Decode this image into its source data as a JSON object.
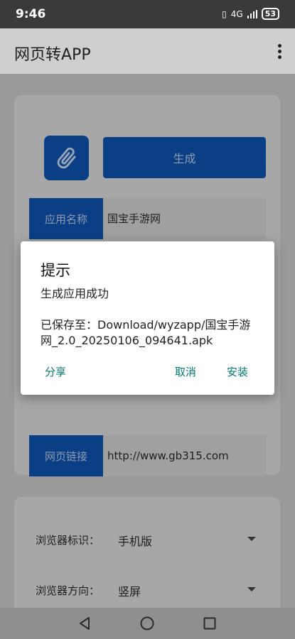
{
  "status_bar": {
    "time": "9:46",
    "network": "4G",
    "battery": "53"
  },
  "app_bar": {
    "title": "网页转APP",
    "menu_icon": "more-vert-icon"
  },
  "form": {
    "attach_icon": "paperclip-icon",
    "generate_label": "生成",
    "app_name_label": "应用名称",
    "app_name_value": "国宝手游网",
    "url_label": "网页链接",
    "url_value": "http://www.gb315.com"
  },
  "settings": {
    "ua_label": "浏览器标识：",
    "ua_value": "手机版",
    "orientation_label": "浏览器方向：",
    "orientation_value": "竖屏"
  },
  "dialog": {
    "title": "提示",
    "message_line1": "生成应用成功",
    "message_line2": "已保存至：Download/wyzapp/国宝手游网_2.0_20250106_094641.apk",
    "share_label": "分享",
    "cancel_label": "取消",
    "install_label": "安装"
  },
  "colors": {
    "primary": "#1565C0",
    "accent": "#00897B"
  }
}
